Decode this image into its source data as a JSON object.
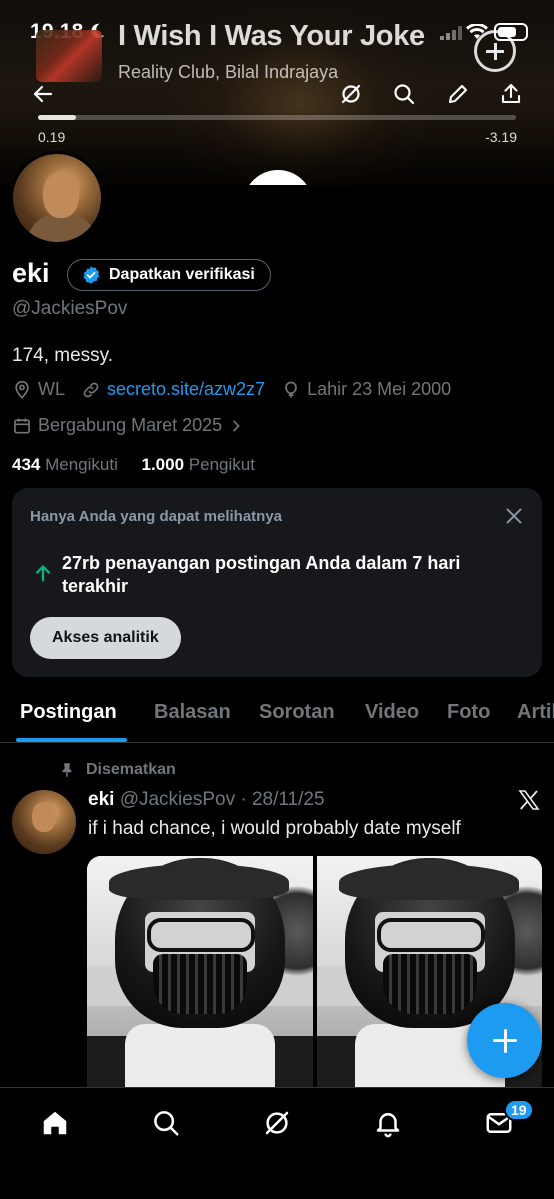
{
  "status_bar": {
    "time": "19.18"
  },
  "now_playing": {
    "title": "I Wish I Was Your Joke",
    "artist": "Reality Club, Bilal Indrajaya",
    "elapsed": "0.19",
    "remaining": "-3.19",
    "progress_fraction": 0.08
  },
  "profile": {
    "display_name": "eki",
    "verify_label": "Dapatkan verifikasi",
    "handle": "@JackiesPov",
    "bio": "174, messy.",
    "location": "WL",
    "website": "secreto.site/azw2z7",
    "birthday": "Lahir 23 Mei 2000",
    "joined": "Bergabung Maret 2025",
    "following_count": "434",
    "following_label": "Mengikuti",
    "followers_count": "1.000",
    "followers_label": "Pengikut"
  },
  "analytics_card": {
    "private_note": "Hanya Anda yang dapat melihatnya",
    "message": "27rb penayangan postingan Anda dalam 7 hari terakhir",
    "button": "Akses analitik"
  },
  "tabs": [
    {
      "label": "Postingan",
      "active": true
    },
    {
      "label": "Balasan",
      "active": false
    },
    {
      "label": "Sorotan",
      "active": false
    },
    {
      "label": "Video",
      "active": false
    },
    {
      "label": "Foto",
      "active": false
    },
    {
      "label": "Artikel",
      "active": false
    }
  ],
  "post": {
    "pinned_label": "Disematkan",
    "name": "eki",
    "meta": "@JackiesPov · 28/11/25",
    "text": "if i had chance, i would probably date myself"
  },
  "bottom_nav": {
    "items": [
      "home-icon",
      "search-icon",
      "grok-icon",
      "notifications-icon",
      "messages-icon"
    ],
    "messages_badge": "19"
  },
  "colors": {
    "accent": "#1d9bf0",
    "background": "#000000",
    "secondary_text": "#71767b",
    "growth_green": "#00ba7c"
  }
}
